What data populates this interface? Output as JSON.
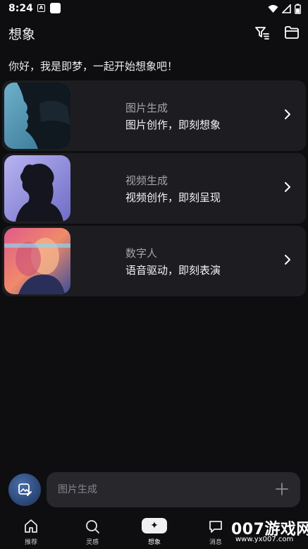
{
  "status_bar": {
    "time": "8:24",
    "notification_letter": "A",
    "icons": [
      "wifi-icon",
      "signal-icon",
      "battery-icon"
    ]
  },
  "header": {
    "title": "想象",
    "icons": [
      "filter-icon",
      "folder-icon"
    ]
  },
  "greeting": "你好，我是即梦，一起开始想象吧！",
  "cards": [
    {
      "title": "图片生成",
      "subtitle": "图片创作，即刻想象",
      "icon": "chevron-right-icon"
    },
    {
      "title": "视频生成",
      "subtitle": "视频创作，即刻呈现",
      "icon": "chevron-right-icon"
    },
    {
      "title": "数字人",
      "subtitle": "语音驱动，即刻表演",
      "icon": "chevron-right-icon"
    }
  ],
  "input": {
    "placeholder": "图片生成",
    "left_icon": "image-edit-icon",
    "right_icon": "plus-icon"
  },
  "bottom_nav": [
    {
      "label": "推荐",
      "icon": "home-icon",
      "active": false
    },
    {
      "label": "灵感",
      "icon": "search-icon",
      "active": false
    },
    {
      "label": "想象",
      "icon": "sparkle-icon",
      "active": true,
      "glyph": "✦"
    },
    {
      "label": "消息",
      "icon": "message-icon",
      "active": false
    }
  ],
  "watermark": {
    "brand": "007游戏网",
    "url": "www.yx007.com"
  },
  "colors": {
    "background": "#0e0e10",
    "card": "#1d1d21",
    "input": "#27272c",
    "accent_button": "#2d4a7a"
  }
}
